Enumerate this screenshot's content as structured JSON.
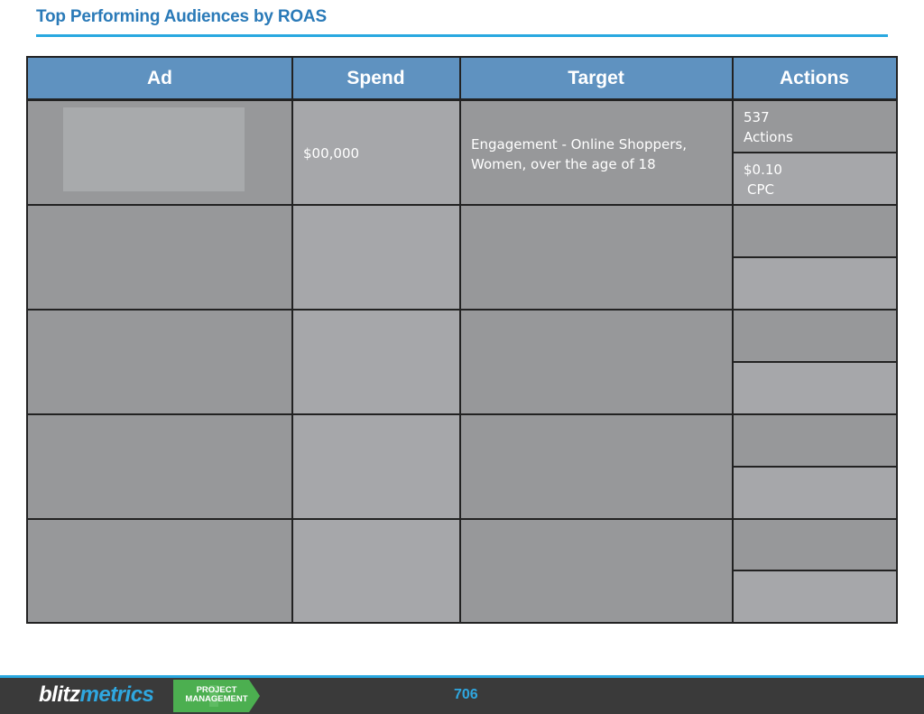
{
  "slide": {
    "title": "Top Performing Audiences by ROAS"
  },
  "table": {
    "headers": [
      "Ad",
      "Spend",
      "Target",
      "Actions"
    ],
    "rows": [
      {
        "ad": "",
        "spend": "$00,000",
        "target": "Engagement -  Online Shoppers, Women, over the age of 18",
        "actions_top_value": "537",
        "actions_top_label": "Actions",
        "actions_bottom_value": "$0.10",
        "actions_bottom_label": "CPC"
      },
      {
        "ad": "",
        "spend": "",
        "target": "",
        "actions_top_value": "",
        "actions_top_label": "",
        "actions_bottom_value": "",
        "actions_bottom_label": ""
      },
      {
        "ad": "",
        "spend": "",
        "target": "",
        "actions_top_value": "",
        "actions_top_label": "",
        "actions_bottom_value": "",
        "actions_bottom_label": ""
      },
      {
        "ad": "",
        "spend": "",
        "target": "",
        "actions_top_value": "",
        "actions_top_label": "",
        "actions_bottom_value": "",
        "actions_bottom_label": ""
      },
      {
        "ad": "",
        "spend": "",
        "target": "",
        "actions_top_value": "",
        "actions_top_label": "",
        "actions_bottom_value": "",
        "actions_bottom_label": ""
      }
    ]
  },
  "footer": {
    "brand_part1": "blitz",
    "brand_part2": "metrics",
    "badge_line1": "PROJECT",
    "badge_line2": "MANAGEMENT",
    "page_number": "706"
  },
  "colors": {
    "title": "#2a7ab8",
    "rule": "#29a8e0",
    "header_bg": "#5f92c0",
    "cell_dark": "#97989a",
    "cell_light": "#a6a7aa",
    "footer_bg": "#3a3a3a",
    "badge_green": "#4caf50"
  }
}
